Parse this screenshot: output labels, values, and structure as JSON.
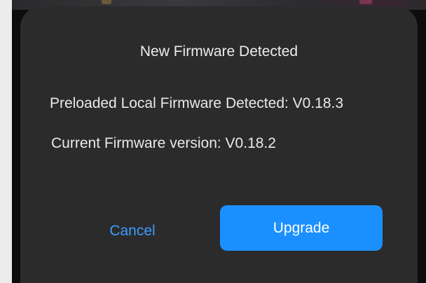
{
  "dialog": {
    "title": "New Firmware Detected",
    "preloaded_text": "Preloaded Local Firmware Detected: V0.18.3",
    "current_text": "Current Firmware version: V0.18.2",
    "cancel_label": "Cancel",
    "upgrade_label": "Upgrade"
  },
  "colors": {
    "dialog_background": "#2b2b2b",
    "accent": "#1a90ff",
    "cancel_text": "#3d9bff",
    "text": "#ededed"
  }
}
